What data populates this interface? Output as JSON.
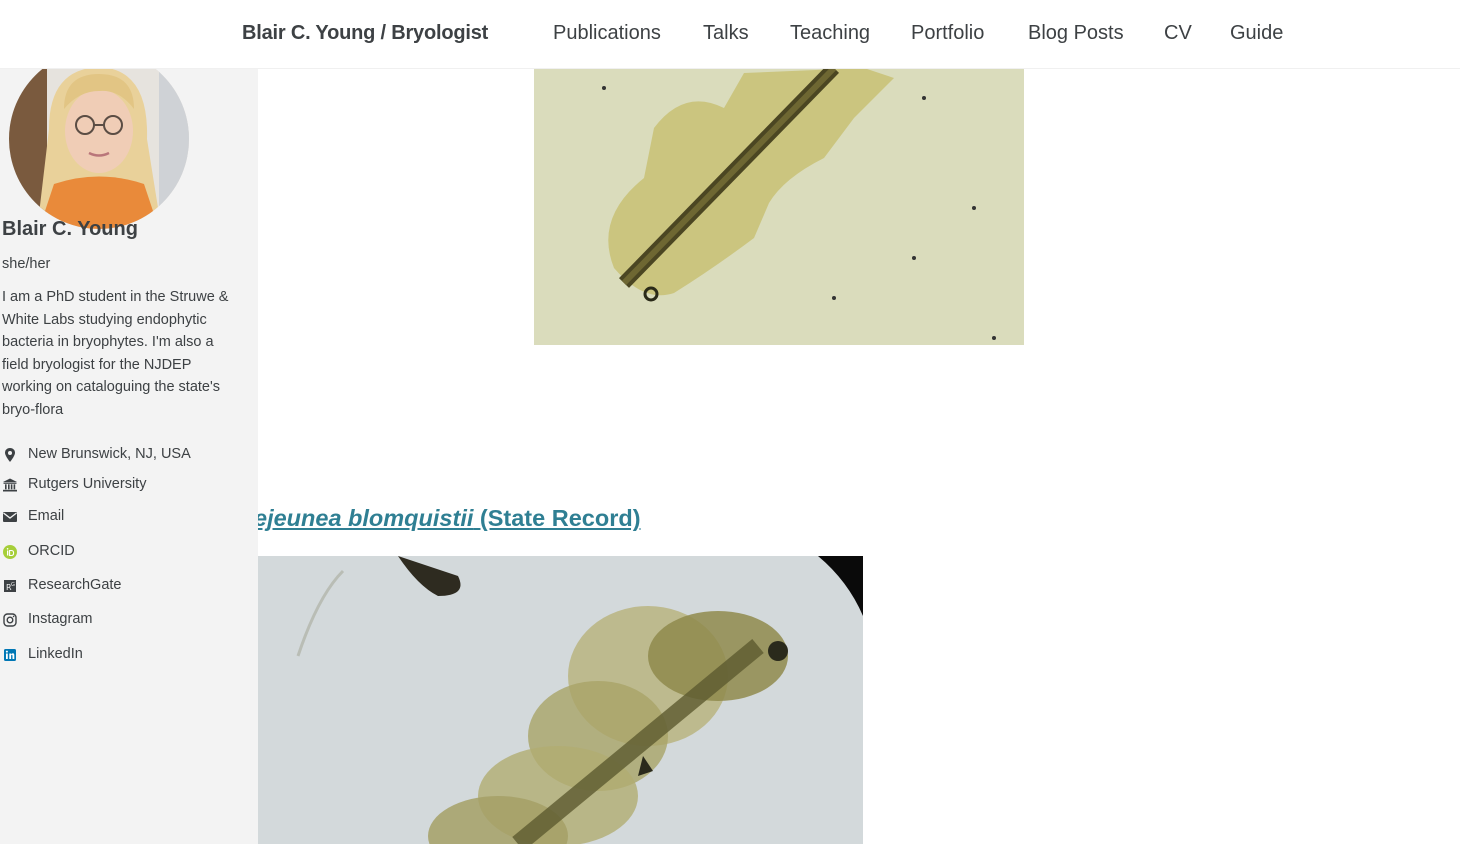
{
  "masthead": {
    "site_title": "Blair C. Young / Bryologist",
    "nav": [
      {
        "label": "Publications"
      },
      {
        "label": "Talks"
      },
      {
        "label": "Teaching"
      },
      {
        "label": "Portfolio"
      },
      {
        "label": "Blog Posts"
      },
      {
        "label": "CV"
      },
      {
        "label": "Guide"
      }
    ]
  },
  "sidebar": {
    "name": "Blair C. Young",
    "pronouns": "she/her",
    "bio": "I am a PhD student in the Struwe & White Labs studying endophytic bacteria in bryophytes. I'm also a field bryologist for the NJDEP working on cataloguing the state's bryo-flora",
    "links": [
      {
        "label": "New Brunswick, NJ, USA",
        "icon": "map-marker-icon"
      },
      {
        "label": "Rutgers University",
        "icon": "university-icon"
      },
      {
        "label": "Email",
        "icon": "envelope-icon"
      },
      {
        "label": "ORCID",
        "icon": "orcid-icon",
        "color": "#a6ce39"
      },
      {
        "label": "ResearchGate",
        "icon": "researchgate-icon"
      },
      {
        "label": "Instagram",
        "icon": "instagram-icon"
      },
      {
        "label": "LinkedIn",
        "icon": "linkedin-icon",
        "color": "#0077b5"
      }
    ]
  },
  "main": {
    "record": {
      "species": "ejeunea blomquistii",
      "suffix": " (State Record)"
    }
  },
  "colors": {
    "link": "#2f7f93",
    "sidebar_bg": "#f3f3f3",
    "text": "#3d4144"
  }
}
